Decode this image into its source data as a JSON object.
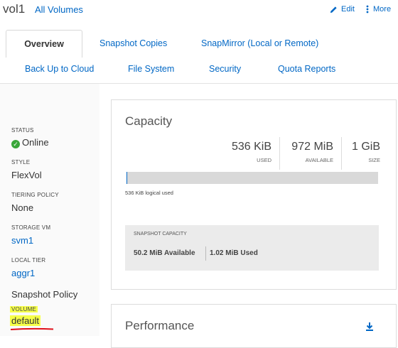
{
  "header": {
    "volume_name": "vol1",
    "breadcrumb_link": "All Volumes",
    "edit_label": "Edit",
    "more_label": "More"
  },
  "tabs": {
    "overview": "Overview",
    "snapshot_copies": "Snapshot Copies",
    "snapmirror": "SnapMirror (Local or Remote)",
    "backup_cloud": "Back Up to Cloud",
    "file_system": "File System",
    "security": "Security",
    "quota_reports": "Quota Reports"
  },
  "properties": {
    "status_label": "STATUS",
    "status_value": "Online",
    "style_label": "STYLE",
    "style_value": "FlexVol",
    "tiering_label": "TIERING POLICY",
    "tiering_value": "None",
    "svm_label": "STORAGE VM",
    "svm_value": "svm1",
    "tier_label": "LOCAL TIER",
    "tier_value": "aggr1",
    "snapshot_policy_label": "Snapshot Policy",
    "volume_label": "VOLUME",
    "volume_value": "default"
  },
  "capacity": {
    "title": "Capacity",
    "used_value": "536 KiB",
    "used_label": "USED",
    "available_value": "972 MiB",
    "available_label": "AVAILABLE",
    "size_value": "1 GiB",
    "size_label": "SIZE",
    "used_fraction": 0.0005,
    "logical_used": "536 KiB logical used",
    "snapshot_label": "SNAPSHOT CAPACITY",
    "snapshot_available": "50.2 MiB Available",
    "snapshot_used": "1.02 MiB Used"
  },
  "performance": {
    "title": "Performance"
  },
  "colors": {
    "link": "#0067c5",
    "status_online": "#3aa63a",
    "highlight": "#f6ff4a",
    "annotation_underline": "#e0101a"
  },
  "icons": {
    "edit": "pencil-icon",
    "more": "vertical-dots-icon",
    "status": "check-circle-icon",
    "download": "download-icon"
  }
}
